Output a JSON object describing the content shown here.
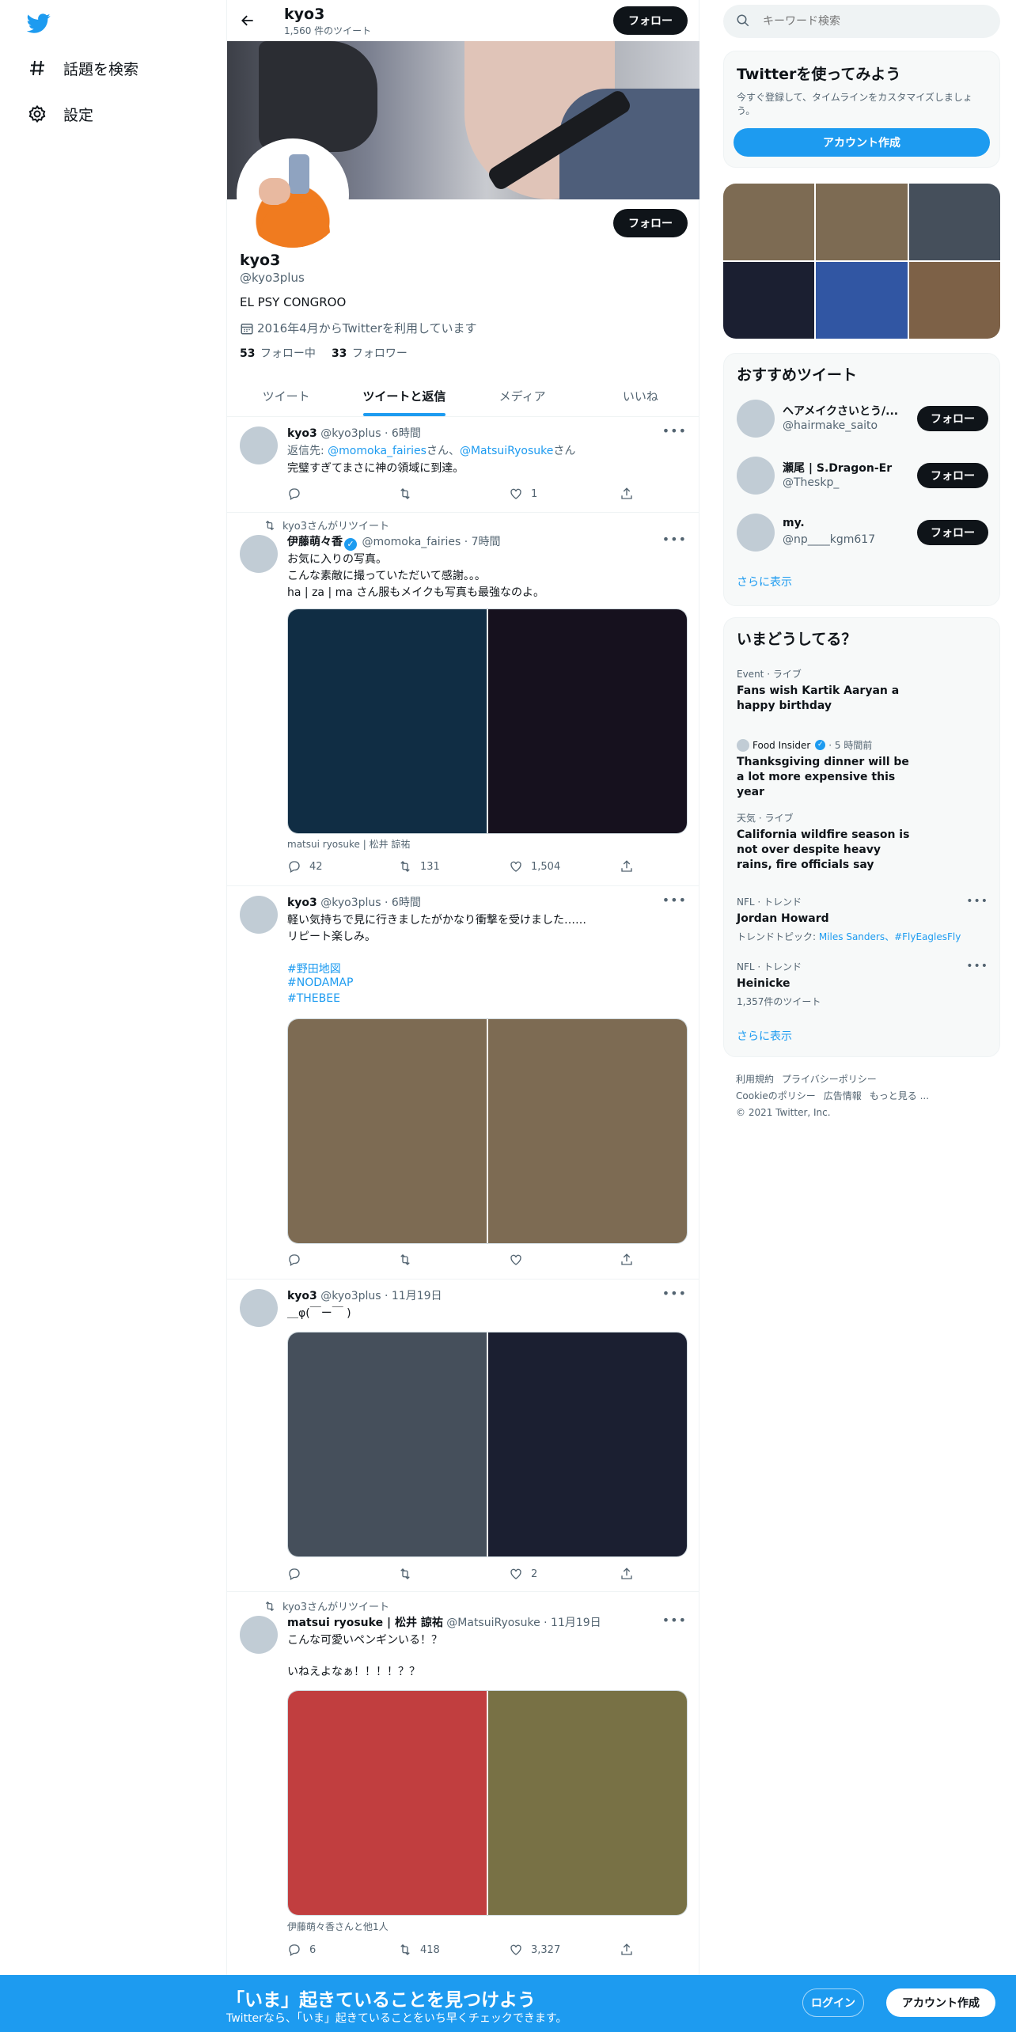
{
  "nav": {
    "explore_label": "話題を検索",
    "settings_label": "設定"
  },
  "header": {
    "name": "kyo3",
    "tweet_count": "1,560 件のツイート",
    "follow_label": "フォロー"
  },
  "profile": {
    "name": "kyo3",
    "handle": "@kyo3plus",
    "bio": "EL PSY CONGROO",
    "joined": "2016年4月からTwitterを利用しています",
    "following_count": "53",
    "following_label": "フォロー中",
    "followers_count": "33",
    "followers_label": "フォロワー",
    "follow_label": "フォロー"
  },
  "tabs": [
    "ツイート",
    "ツイートと返信",
    "メディア",
    "いいね"
  ],
  "tweets": [
    {
      "name": "kyo3",
      "handle": "@kyo3plus",
      "time": "6時間",
      "reply_prefix": "返信先: ",
      "reply_to_1": "@momoka_fairies",
      "reply_mid": "さん、",
      "reply_to_2": "@MatsuiRyosuke",
      "reply_suffix": "さん",
      "text": "完璧すぎてまさに神の領域に到達。",
      "replies": "",
      "retweets": "",
      "likes": "1"
    },
    {
      "retweeted_by": "kyo3さんがリツイート",
      "name": "伊藤萌々香",
      "handle": "@momoka_fairies",
      "time": "7時間",
      "lines": [
        "お気に入りの写真。",
        "こんな素敵に撮っていただいて感謝。。。",
        "ha | za | ma さん服もメイクも写真も最強なのよ。"
      ],
      "media_colors": [
        "#102d44",
        "#16111e"
      ],
      "caption": "matsui ryosuke | 松井 諒祐",
      "replies": "42",
      "retweets": "131",
      "likes": "1,504"
    },
    {
      "name": "kyo3",
      "handle": "@kyo3plus",
      "time": "6時間",
      "lines": [
        "軽い気持ちで見に行きましたがかなり衝撃を受けました……",
        "リピート楽しみ。"
      ],
      "hashtags": [
        "#野田地図",
        "#NODAMAP",
        "#THEBEE"
      ],
      "media_colors": [
        "#7d6b53",
        "#7d6b53"
      ],
      "replies": "",
      "retweets": "",
      "likes": ""
    },
    {
      "name": "kyo3",
      "handle": "@kyo3plus",
      "time": "11月19日",
      "text": "＿φ(￣ー￣ )",
      "media_colors": [
        "#454f5b",
        "#1b1f31"
      ],
      "replies": "",
      "retweets": "",
      "likes": "2"
    },
    {
      "retweeted_by": "kyo3さんがリツイート",
      "name": "matsui ryosuke | 松井 諒祐",
      "handle": "@MatsuiRyosuke",
      "time": "11月19日",
      "lines": [
        "こんな可愛いペンギンいる！？",
        "",
        "いねえよなぁ！！！！？？"
      ],
      "media_colors": [
        "#c13e3f",
        "#787145"
      ],
      "caption": "伊藤萌々香さんと他1人",
      "replies": "6",
      "retweets": "418",
      "likes": "3,327"
    }
  ],
  "search": {
    "placeholder": "キーワード検索"
  },
  "signup_card": {
    "title": "Twitterを使ってみよう",
    "subtitle": "今すぐ登録して、タイムラインをカスタマイズしましょう。",
    "button": "アカウント作成"
  },
  "media_grid_colors": [
    "#7d6b53",
    "#7d6b53",
    "#454f5b",
    "#1b1f31",
    "#3156a3",
    "#7d6147"
  ],
  "who_to_follow": {
    "title": "おすすめツイート",
    "items": [
      {
        "name": "ヘアメイクさいとう/...",
        "handle": "@hairmake_saito",
        "button": "フォロー"
      },
      {
        "name": "瀬尾 | S.Dragon-Er",
        "handle": "@Theskp_",
        "button": "フォロー"
      },
      {
        "name": "my.",
        "handle": "@np____kgm617",
        "button": "フォロー"
      }
    ],
    "more": "さらに表示"
  },
  "trends": {
    "title": "いまどうしてる？",
    "items": [
      {
        "category": "Event · ライブ",
        "title": "Fans wish Kartik Aaryan a happy birthday"
      },
      {
        "source": "Food Insider",
        "time": "· 5 時間前",
        "title": "Thanksgiving dinner will be a lot more expensive this year"
      },
      {
        "category": "天気 · ライブ",
        "title": "California wildfire season is not over despite heavy rains, fire officials say"
      },
      {
        "category": "NFL · トレンド",
        "title": "Jordan Howard",
        "sub_prefix": "トレンドトピック: ",
        "sub_links": "Miles Sanders、#FlyEaglesFly"
      },
      {
        "category": "NFL · トレンド",
        "title": "Heinicke",
        "sub": "1,357件のツイート"
      }
    ],
    "more": "さらに表示"
  },
  "footer": {
    "links": [
      "利用規約",
      "プライバシーポリシー",
      "Cookieのポリシー",
      "広告情報",
      "もっと見る ..."
    ],
    "copyright": "© 2021 Twitter, Inc."
  },
  "bottom_bar": {
    "title": "「いま」起きていることを見つけよう",
    "subtitle": "Twitterなら、「いま」起きていることをいち早くチェックできます。",
    "login": "ログイン",
    "signup": "アカウント作成"
  },
  "colors": {
    "accent": "#1d9bf0",
    "text": "#0f1419",
    "muted": "#536471"
  }
}
